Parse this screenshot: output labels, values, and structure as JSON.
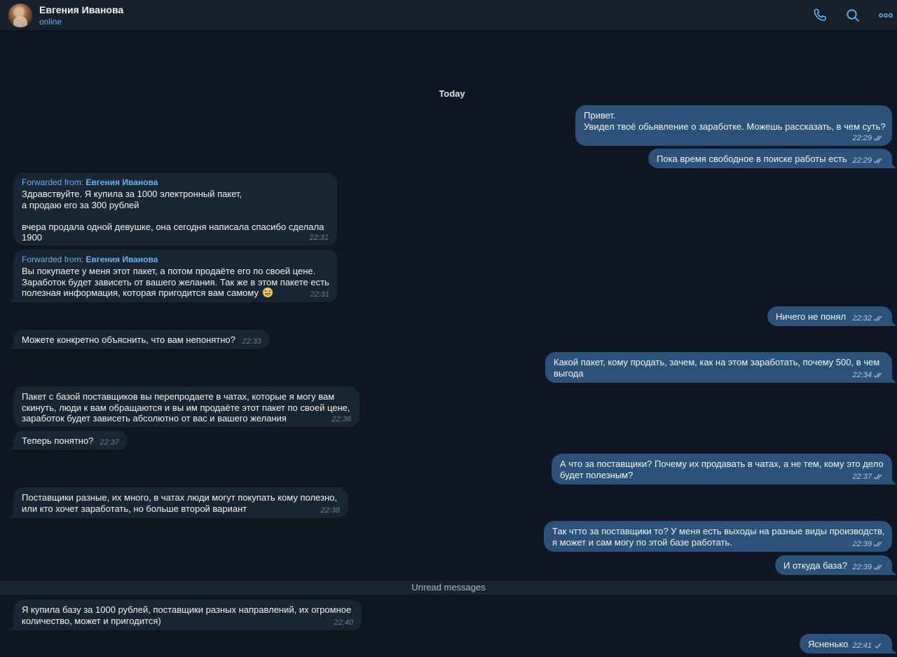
{
  "header": {
    "name": "Евгения Иванова",
    "status": "online",
    "icons": [
      "phone-icon",
      "search-icon",
      "more-icon"
    ]
  },
  "chat": {
    "date": "Today",
    "unread": "Unread messages",
    "forwarded_prefix": "Forwarded from:",
    "messages": [
      {
        "dir": "out",
        "lines": [
          "Привет.",
          "Увидел твоё обьявление о заработке. Можешь рассказать, в чем суть?"
        ],
        "time": "22:29",
        "read": true
      },
      {
        "dir": "out",
        "lines": [
          "Пока время свободное в поиске работы есть"
        ],
        "time": "22:29",
        "read": true
      },
      {
        "dir": "in",
        "forwarded_from": "Евгения Иванова",
        "lines": [
          "Здравствуйте. Я купила за 1000 электронный пакет,",
          "а продаю его за 300 рублей",
          "",
          "вчера продала одной девушке, она сегодня написала  спасибо  сделала",
          "1900"
        ],
        "time": "22:31"
      },
      {
        "dir": "in",
        "forwarded_from": "Евгения Иванова",
        "lines": [
          "Вы покупаете у меня этот пакет, а потом продаёте его по своей цене.",
          "Заработок будет зависеть от вашего желания. Так же в этом пакете есть",
          "полезная информация, которая пригодится вам самому"
        ],
        "emoji": "grinning-face-icon",
        "time": "22:31"
      },
      {
        "dir": "out",
        "lines": [
          "Ничего не понял"
        ],
        "time": "22:32",
        "read": true
      },
      {
        "dir": "in",
        "lines": [
          "Можете конкретно объяснить, что вам непонятно?"
        ],
        "time": "22:33"
      },
      {
        "dir": "out",
        "lines": [
          "Какой пакет, кому продать, зачем, как на этом заработать, почему 500, в чем",
          "выгода"
        ],
        "time": "22:34",
        "read": true
      },
      {
        "dir": "in",
        "lines": [
          "Пакет с базой поставщиков вы перепродаете в чатах, которые я могу вам",
          "скинуть, люди к вам обращаются и вы им продаёте этот пакет по своей цене,",
          "заработок будет зависеть абсолютно от вас и вашего желания"
        ],
        "time": "22:36"
      },
      {
        "dir": "in",
        "lines": [
          "Теперь понятно?"
        ],
        "time": "22:37"
      },
      {
        "dir": "out",
        "lines": [
          "А что за поставщики? Почему их продавать в чатах, а не тем, кому это дело",
          "будет полезным?"
        ],
        "time": "22:37",
        "read": true
      },
      {
        "dir": "in",
        "lines": [
          "Поставщики разные, их много, в чатах люди могут покупать кому полезно,",
          "или кто хочет заработать, но больше второй вариант"
        ],
        "time": "22:38"
      },
      {
        "dir": "out",
        "lines": [
          "Так чтто за поставщики то? У меня есть выходы на разные виды производств,",
          "я может и сам могу по этой базе работать."
        ],
        "time": "22:39",
        "read": true
      },
      {
        "dir": "out",
        "lines": [
          "И откуда база?"
        ],
        "time": "22:39",
        "read": true
      },
      {
        "dir": "in",
        "lines": [
          "Я купила базу за 1000 рублей, поставщики разных направлений, их огромное",
          "количество, может и пригодится)"
        ],
        "time": "22:40"
      },
      {
        "dir": "out",
        "lines": [
          "Ясненько"
        ],
        "time": "22:41",
        "read": false
      }
    ]
  },
  "colors": {
    "background": "#0e1621",
    "header": "#17212b",
    "incoming_bubble": "#182533",
    "outgoing_bubble": "#2b5278",
    "accent": "#6ab2f2"
  }
}
